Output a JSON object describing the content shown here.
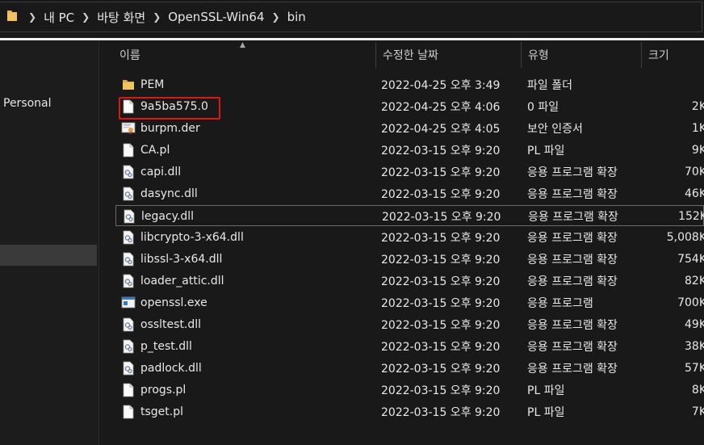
{
  "breadcrumb": [
    "내 PC",
    "바탕 화면",
    "OpenSSL-Win64",
    "bin"
  ],
  "sidebar": {
    "items": [
      "Personal"
    ]
  },
  "columns": {
    "name": "이름",
    "date": "수정한 날짜",
    "type": "유형",
    "size": "크기"
  },
  "files": [
    {
      "name": "PEM",
      "date": "2022-04-25 오후 3:49",
      "type": "파일 폴더",
      "size": "",
      "icon": "folder-icon"
    },
    {
      "name": "9a5ba575.0",
      "date": "2022-04-25 오후 4:06",
      "type": "0 파일",
      "size": "2K",
      "icon": "file-icon"
    },
    {
      "name": "burpm.der",
      "date": "2022-04-25 오후 4:05",
      "type": "보안 인증서",
      "size": "1K",
      "icon": "certificate-icon"
    },
    {
      "name": "CA.pl",
      "date": "2022-03-15 오후 9:20",
      "type": "PL 파일",
      "size": "9K",
      "icon": "file-icon"
    },
    {
      "name": "capi.dll",
      "date": "2022-03-15 오후 9:20",
      "type": "응용 프로그램 확장",
      "size": "70K",
      "icon": "dll-icon"
    },
    {
      "name": "dasync.dll",
      "date": "2022-03-15 오후 9:20",
      "type": "응용 프로그램 확장",
      "size": "46K",
      "icon": "dll-icon"
    },
    {
      "name": "legacy.dll",
      "date": "2022-03-15 오후 9:20",
      "type": "응용 프로그램 확장",
      "size": "152K",
      "icon": "dll-icon"
    },
    {
      "name": "libcrypto-3-x64.dll",
      "date": "2022-03-15 오후 9:20",
      "type": "응용 프로그램 확장",
      "size": "5,008K",
      "icon": "dll-icon"
    },
    {
      "name": "libssl-3-x64.dll",
      "date": "2022-03-15 오후 9:20",
      "type": "응용 프로그램 확장",
      "size": "754K",
      "icon": "dll-icon"
    },
    {
      "name": "loader_attic.dll",
      "date": "2022-03-15 오후 9:20",
      "type": "응용 프로그램 확장",
      "size": "82K",
      "icon": "dll-icon"
    },
    {
      "name": "openssl.exe",
      "date": "2022-03-15 오후 9:20",
      "type": "응용 프로그램",
      "size": "700K",
      "icon": "exe-icon"
    },
    {
      "name": "ossltest.dll",
      "date": "2022-03-15 오후 9:20",
      "type": "응용 프로그램 확장",
      "size": "49K",
      "icon": "dll-icon"
    },
    {
      "name": "p_test.dll",
      "date": "2022-03-15 오후 9:20",
      "type": "응용 프로그램 확장",
      "size": "38K",
      "icon": "dll-icon"
    },
    {
      "name": "padlock.dll",
      "date": "2022-03-15 오후 9:20",
      "type": "응용 프로그램 확장",
      "size": "57K",
      "icon": "dll-icon"
    },
    {
      "name": "progs.pl",
      "date": "2022-03-15 오후 9:20",
      "type": "PL 파일",
      "size": "8K",
      "icon": "file-icon"
    },
    {
      "name": "tsget.pl",
      "date": "2022-03-15 오후 9:20",
      "type": "PL 파일",
      "size": "7K",
      "icon": "file-icon"
    }
  ],
  "colors": {
    "accent_highlight": "#e01515",
    "folder": "#e8b64a"
  }
}
